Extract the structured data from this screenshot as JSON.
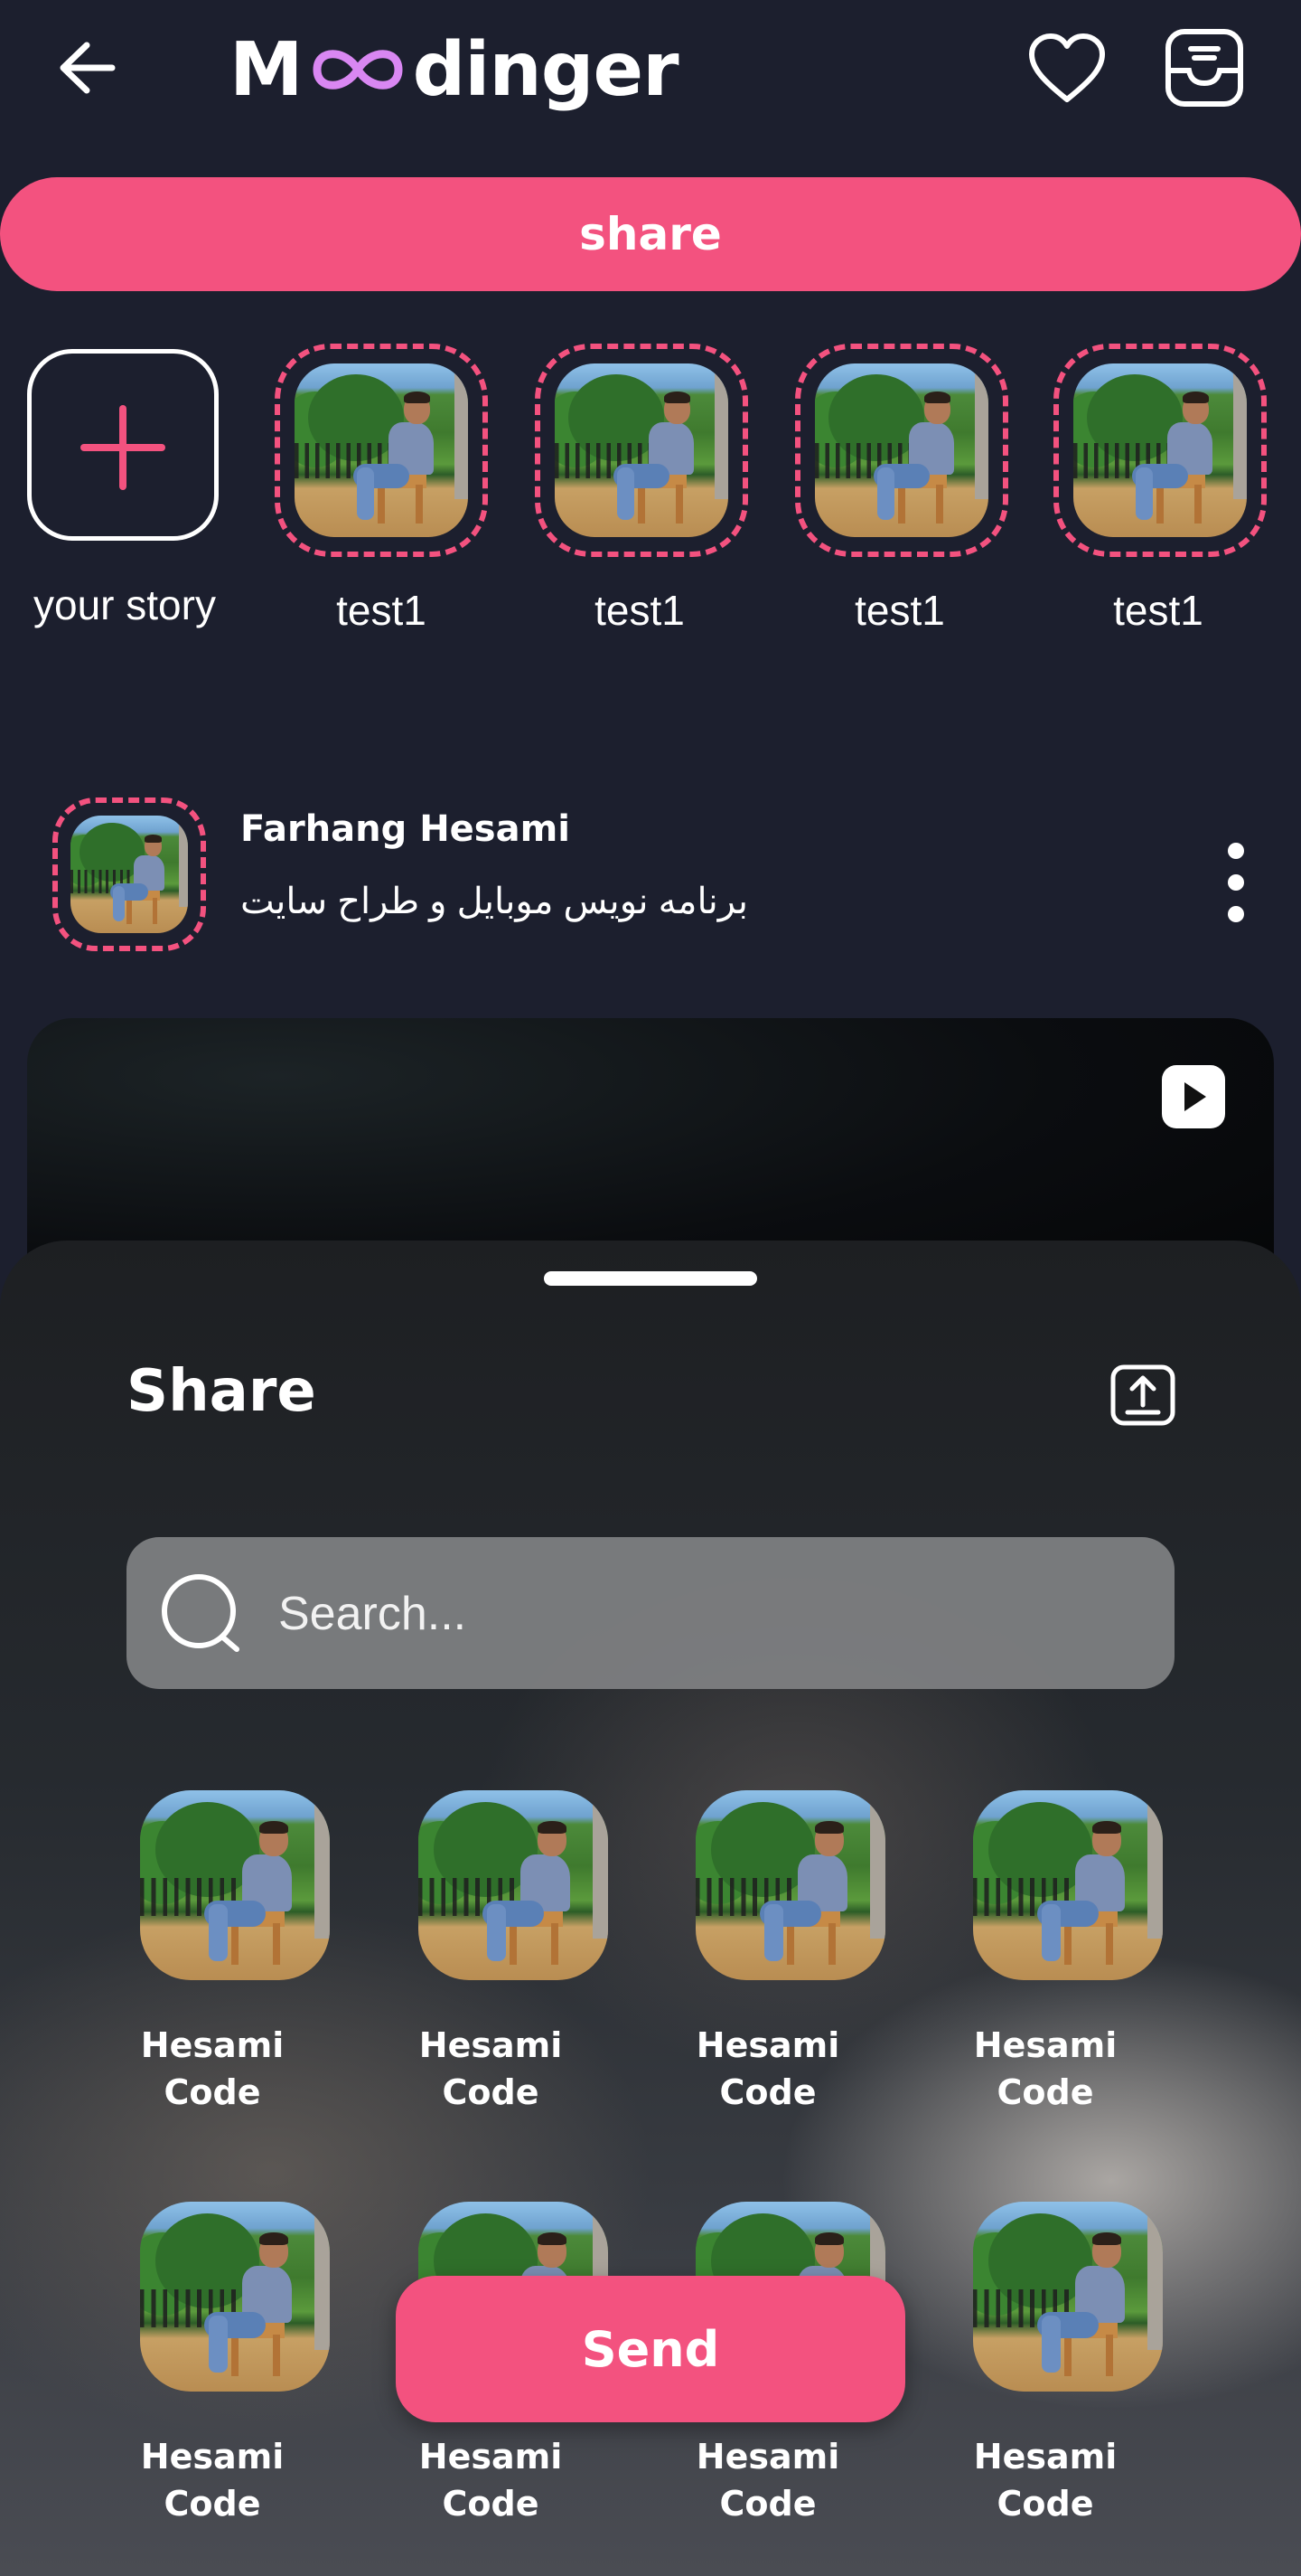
{
  "header": {
    "logo": {
      "prefix": "M",
      "suffix": "dinger",
      "infinity_color": "#d987f2"
    },
    "icons": [
      "back-arrow-icon",
      "heart-icon",
      "inbox-icon"
    ]
  },
  "share_button": {
    "label": "share"
  },
  "stories": {
    "own": {
      "label": "your story"
    },
    "items": [
      {
        "label": "test1"
      },
      {
        "label": "test1"
      },
      {
        "label": "test1"
      },
      {
        "label": "test1"
      }
    ]
  },
  "post": {
    "author": "Farhang Hesami",
    "bio": "برنامه نویس موبایل و طراح سایت"
  },
  "share_sheet": {
    "title": "Share",
    "search": {
      "placeholder": "Search...",
      "value": ""
    },
    "contacts": [
      {
        "name": "Hesami\nCode"
      },
      {
        "name": "Hesami\nCode"
      },
      {
        "name": "Hesami\nCode"
      },
      {
        "name": "Hesami\nCode"
      },
      {
        "name": "Hesami\nCode"
      },
      {
        "name": "Hesami\nCode"
      },
      {
        "name": "Hesami\nCode"
      },
      {
        "name": "Hesami\nCode"
      }
    ],
    "send_label": "Send"
  },
  "colors": {
    "accent": "#f3527f",
    "background": "#1c1f2e"
  }
}
